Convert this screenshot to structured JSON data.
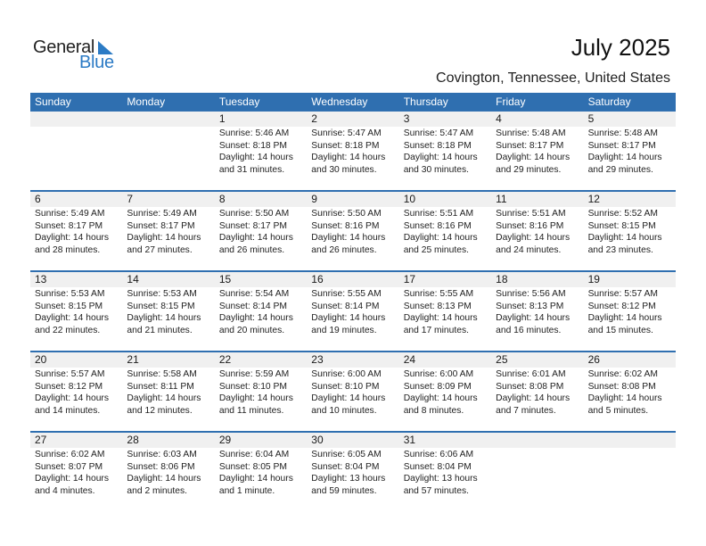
{
  "logo": {
    "general": "General",
    "blue": "Blue",
    "brand_color": "#2c7bc5"
  },
  "header": {
    "title": "July 2025",
    "location": "Covington, Tennessee, United States"
  },
  "theme": {
    "header_bg": "#2f6fb0",
    "row_bg": "#f0f0f0"
  },
  "weekdays": [
    "Sunday",
    "Monday",
    "Tuesday",
    "Wednesday",
    "Thursday",
    "Friday",
    "Saturday"
  ],
  "weeks": [
    [
      null,
      null,
      {
        "day": "1",
        "sunrise": "Sunrise: 5:46 AM",
        "sunset": "Sunset: 8:18 PM",
        "daylight1": "Daylight: 14 hours",
        "daylight2": "and 31 minutes."
      },
      {
        "day": "2",
        "sunrise": "Sunrise: 5:47 AM",
        "sunset": "Sunset: 8:18 PM",
        "daylight1": "Daylight: 14 hours",
        "daylight2": "and 30 minutes."
      },
      {
        "day": "3",
        "sunrise": "Sunrise: 5:47 AM",
        "sunset": "Sunset: 8:18 PM",
        "daylight1": "Daylight: 14 hours",
        "daylight2": "and 30 minutes."
      },
      {
        "day": "4",
        "sunrise": "Sunrise: 5:48 AM",
        "sunset": "Sunset: 8:17 PM",
        "daylight1": "Daylight: 14 hours",
        "daylight2": "and 29 minutes."
      },
      {
        "day": "5",
        "sunrise": "Sunrise: 5:48 AM",
        "sunset": "Sunset: 8:17 PM",
        "daylight1": "Daylight: 14 hours",
        "daylight2": "and 29 minutes."
      }
    ],
    [
      {
        "day": "6",
        "sunrise": "Sunrise: 5:49 AM",
        "sunset": "Sunset: 8:17 PM",
        "daylight1": "Daylight: 14 hours",
        "daylight2": "and 28 minutes."
      },
      {
        "day": "7",
        "sunrise": "Sunrise: 5:49 AM",
        "sunset": "Sunset: 8:17 PM",
        "daylight1": "Daylight: 14 hours",
        "daylight2": "and 27 minutes."
      },
      {
        "day": "8",
        "sunrise": "Sunrise: 5:50 AM",
        "sunset": "Sunset: 8:17 PM",
        "daylight1": "Daylight: 14 hours",
        "daylight2": "and 26 minutes."
      },
      {
        "day": "9",
        "sunrise": "Sunrise: 5:50 AM",
        "sunset": "Sunset: 8:16 PM",
        "daylight1": "Daylight: 14 hours",
        "daylight2": "and 26 minutes."
      },
      {
        "day": "10",
        "sunrise": "Sunrise: 5:51 AM",
        "sunset": "Sunset: 8:16 PM",
        "daylight1": "Daylight: 14 hours",
        "daylight2": "and 25 minutes."
      },
      {
        "day": "11",
        "sunrise": "Sunrise: 5:51 AM",
        "sunset": "Sunset: 8:16 PM",
        "daylight1": "Daylight: 14 hours",
        "daylight2": "and 24 minutes."
      },
      {
        "day": "12",
        "sunrise": "Sunrise: 5:52 AM",
        "sunset": "Sunset: 8:15 PM",
        "daylight1": "Daylight: 14 hours",
        "daylight2": "and 23 minutes."
      }
    ],
    [
      {
        "day": "13",
        "sunrise": "Sunrise: 5:53 AM",
        "sunset": "Sunset: 8:15 PM",
        "daylight1": "Daylight: 14 hours",
        "daylight2": "and 22 minutes."
      },
      {
        "day": "14",
        "sunrise": "Sunrise: 5:53 AM",
        "sunset": "Sunset: 8:15 PM",
        "daylight1": "Daylight: 14 hours",
        "daylight2": "and 21 minutes."
      },
      {
        "day": "15",
        "sunrise": "Sunrise: 5:54 AM",
        "sunset": "Sunset: 8:14 PM",
        "daylight1": "Daylight: 14 hours",
        "daylight2": "and 20 minutes."
      },
      {
        "day": "16",
        "sunrise": "Sunrise: 5:55 AM",
        "sunset": "Sunset: 8:14 PM",
        "daylight1": "Daylight: 14 hours",
        "daylight2": "and 19 minutes."
      },
      {
        "day": "17",
        "sunrise": "Sunrise: 5:55 AM",
        "sunset": "Sunset: 8:13 PM",
        "daylight1": "Daylight: 14 hours",
        "daylight2": "and 17 minutes."
      },
      {
        "day": "18",
        "sunrise": "Sunrise: 5:56 AM",
        "sunset": "Sunset: 8:13 PM",
        "daylight1": "Daylight: 14 hours",
        "daylight2": "and 16 minutes."
      },
      {
        "day": "19",
        "sunrise": "Sunrise: 5:57 AM",
        "sunset": "Sunset: 8:12 PM",
        "daylight1": "Daylight: 14 hours",
        "daylight2": "and 15 minutes."
      }
    ],
    [
      {
        "day": "20",
        "sunrise": "Sunrise: 5:57 AM",
        "sunset": "Sunset: 8:12 PM",
        "daylight1": "Daylight: 14 hours",
        "daylight2": "and 14 minutes."
      },
      {
        "day": "21",
        "sunrise": "Sunrise: 5:58 AM",
        "sunset": "Sunset: 8:11 PM",
        "daylight1": "Daylight: 14 hours",
        "daylight2": "and 12 minutes."
      },
      {
        "day": "22",
        "sunrise": "Sunrise: 5:59 AM",
        "sunset": "Sunset: 8:10 PM",
        "daylight1": "Daylight: 14 hours",
        "daylight2": "and 11 minutes."
      },
      {
        "day": "23",
        "sunrise": "Sunrise: 6:00 AM",
        "sunset": "Sunset: 8:10 PM",
        "daylight1": "Daylight: 14 hours",
        "daylight2": "and 10 minutes."
      },
      {
        "day": "24",
        "sunrise": "Sunrise: 6:00 AM",
        "sunset": "Sunset: 8:09 PM",
        "daylight1": "Daylight: 14 hours",
        "daylight2": "and 8 minutes."
      },
      {
        "day": "25",
        "sunrise": "Sunrise: 6:01 AM",
        "sunset": "Sunset: 8:08 PM",
        "daylight1": "Daylight: 14 hours",
        "daylight2": "and 7 minutes."
      },
      {
        "day": "26",
        "sunrise": "Sunrise: 6:02 AM",
        "sunset": "Sunset: 8:08 PM",
        "daylight1": "Daylight: 14 hours",
        "daylight2": "and 5 minutes."
      }
    ],
    [
      {
        "day": "27",
        "sunrise": "Sunrise: 6:02 AM",
        "sunset": "Sunset: 8:07 PM",
        "daylight1": "Daylight: 14 hours",
        "daylight2": "and 4 minutes."
      },
      {
        "day": "28",
        "sunrise": "Sunrise: 6:03 AM",
        "sunset": "Sunset: 8:06 PM",
        "daylight1": "Daylight: 14 hours",
        "daylight2": "and 2 minutes."
      },
      {
        "day": "29",
        "sunrise": "Sunrise: 6:04 AM",
        "sunset": "Sunset: 8:05 PM",
        "daylight1": "Daylight: 14 hours",
        "daylight2": "and 1 minute."
      },
      {
        "day": "30",
        "sunrise": "Sunrise: 6:05 AM",
        "sunset": "Sunset: 8:04 PM",
        "daylight1": "Daylight: 13 hours",
        "daylight2": "and 59 minutes."
      },
      {
        "day": "31",
        "sunrise": "Sunrise: 6:06 AM",
        "sunset": "Sunset: 8:04 PM",
        "daylight1": "Daylight: 13 hours",
        "daylight2": "and 57 minutes."
      },
      null,
      null
    ]
  ]
}
